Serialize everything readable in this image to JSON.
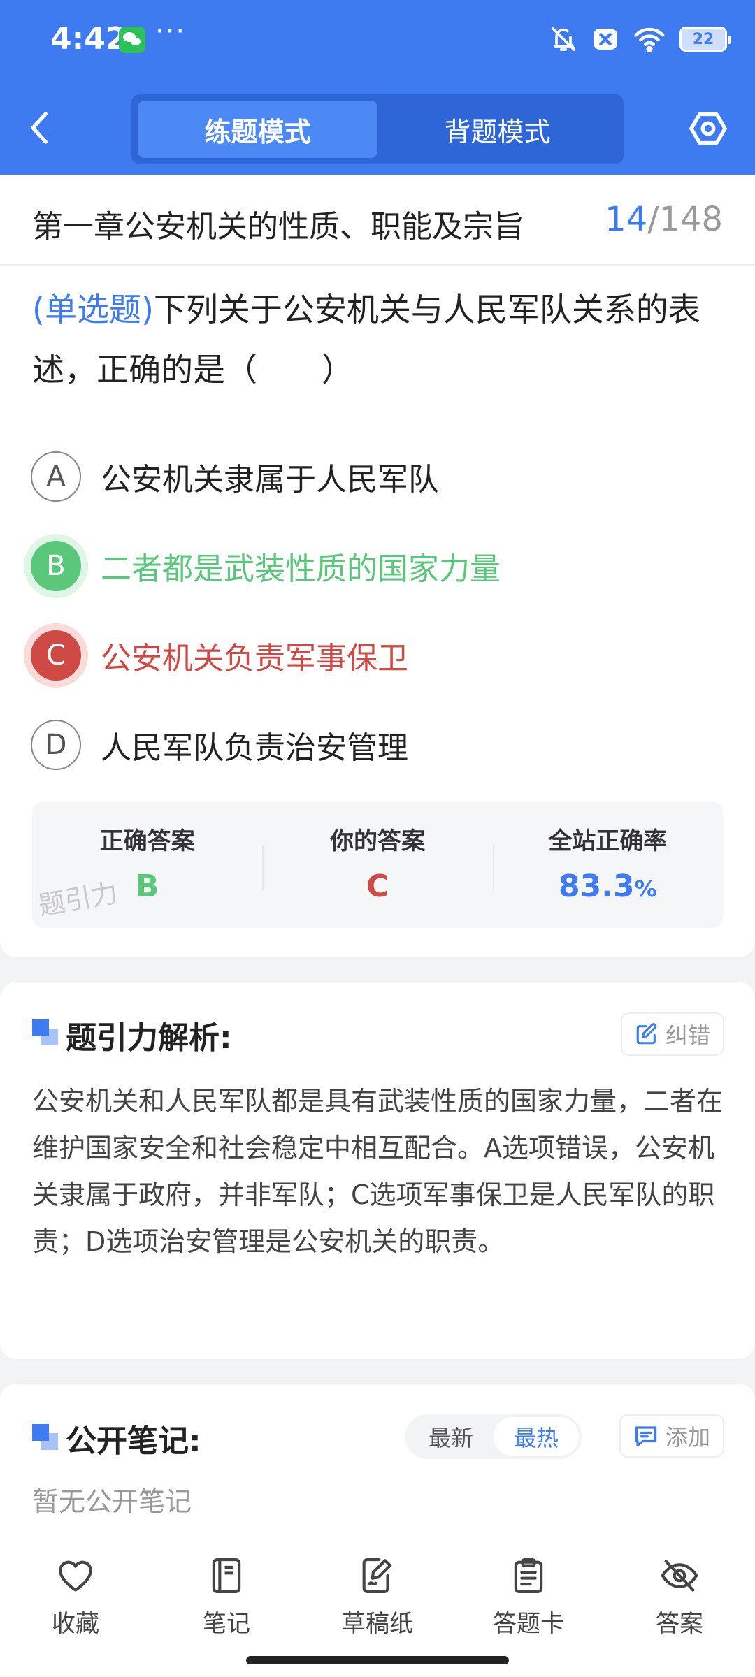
{
  "status_bar": {
    "time": "4:42",
    "dots": "···",
    "battery": "22",
    "icons": [
      "bell-muted-icon",
      "close-box-icon",
      "wifi-icon",
      "battery-icon"
    ]
  },
  "header": {
    "modes": [
      {
        "label": "练题模式",
        "active": true
      },
      {
        "label": "背题模式",
        "active": false
      }
    ]
  },
  "question": {
    "chapter": "第一章公安机关的性质、职能及宗旨",
    "current": "14",
    "total": "/148",
    "type_label": "(单选题)",
    "text": "下列关于公安机关与人民军队关系的表述，正确的是（　　）",
    "options": [
      {
        "letter": "A",
        "text": "公安机关隶属于人民军队",
        "state": "normal"
      },
      {
        "letter": "B",
        "text": "二者都是武装性质的国家力量",
        "state": "correct"
      },
      {
        "letter": "C",
        "text": "公安机关负责军事保卫",
        "state": "wrong"
      },
      {
        "letter": "D",
        "text": "人民军队负责治安管理",
        "state": "normal"
      }
    ]
  },
  "stats": {
    "correct_label": "正确答案",
    "correct_value": "B",
    "yours_label": "你的答案",
    "yours_value": "C",
    "rate_label": "全站正确率",
    "rate_value": "83.3",
    "rate_unit": "%",
    "watermark": "题引力"
  },
  "analysis": {
    "title": "题引力解析:",
    "report_label": "纠错",
    "text": "公安机关和人民军队都是具有武装性质的国家力量，二者在维护国家安全和社会稳定中相互配合。A选项错误，公安机关隶属于政府，并非军队；C选项军事保卫是人民军队的职责；D选项治安管理是公安机关的职责。"
  },
  "notes": {
    "title": "公开笔记:",
    "sort_newest": "最新",
    "sort_hottest": "最热",
    "add_label": "添加",
    "empty_text": "暂无公开笔记"
  },
  "toolbar": {
    "items": [
      {
        "label": "收藏",
        "icon": "heart-icon"
      },
      {
        "label": "笔记",
        "icon": "notebook-icon"
      },
      {
        "label": "草稿纸",
        "icon": "draft-paper-icon"
      },
      {
        "label": "答题卡",
        "icon": "answer-sheet-icon"
      },
      {
        "label": "答案",
        "icon": "eye-off-icon"
      }
    ]
  },
  "colors": {
    "primary": "#3f7bf0",
    "correct": "#5ac77b",
    "wrong": "#cf4a45"
  }
}
